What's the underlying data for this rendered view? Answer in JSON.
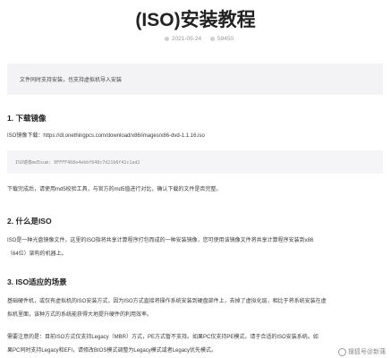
{
  "article": {
    "title": "(ISO)安装教程",
    "date": "2021-05-24",
    "views": "59450",
    "intro": "文件同时支持安装，也支持虚拟机导入安装",
    "sections": [
      {
        "heading": "1. 下载镜像",
        "link_line": "ISO镜像下载：https://dl.onethingpcs.com/download/x86/images/x86-dvd-1.1.16.iso",
        "md5_line": "ISO镜像md5sum: 9FFFF468e4ebbf648c7d21b6f41c1ad2",
        "note": "下载完成后，请使用md5校验工具，与官方的md5值进行对比，确认下载的文件是否完整。"
      },
      {
        "heading": "2. 什么是ISO",
        "body_lines": [
          "ISO是一种光盘镜像文件，这里的ISO指将共享计算程序打包而成的一种安装镜像，您可使用该镜像文件将共享计算程序安装到x86",
          "（64位）架构的机器上。"
        ]
      },
      {
        "heading": "3. ISO适应的场景",
        "body_lines": [
          "基础硬件机，或仅有虚拟机的ISO安装方式，因为ISO方式直接将操作系统安装到硬盘部件上，去掉了虚拟化层，相比于将系统安装在虚",
          "拟机里面，该种方式的系统能获得大地提升硬件的利用效率。",
          "",
          "需要注意的是：目前ISO方式仅支持Legacy（MBR）方式，PE方式暂不支持。如果PC仅支持PE模式，请于合适的ISO安装系统。如",
          "果PC同时支持Legacy和EFI，请修改BIOS模式调整为Legacy模式或者Legacy优先模式。"
        ]
      }
    ]
  },
  "watermark": "搜狐号@新蒲"
}
